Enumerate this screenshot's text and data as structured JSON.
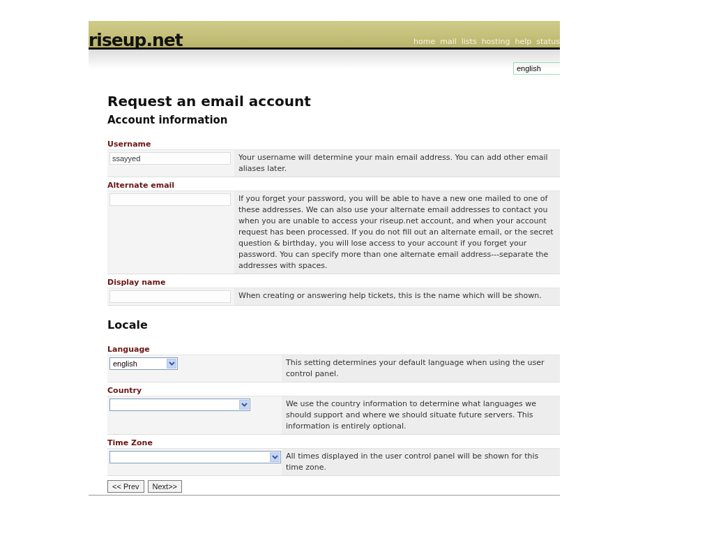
{
  "header": {
    "logo": "riseup.net",
    "nav": [
      "home",
      "mail",
      "lists",
      "hosting",
      "help",
      "status"
    ],
    "language_select": {
      "value": "english"
    }
  },
  "title": "Request an email account",
  "sections": [
    {
      "heading": "Account information",
      "fields": [
        {
          "label": "Username",
          "kind": "text",
          "value": "ssayyed",
          "help": "Your username will determine your main email address. You can add other email aliases later."
        },
        {
          "label": "Alternate email",
          "kind": "text",
          "help": "If you forget your password, you will be able to have a new one mailed to one of these addresses. We can also use your alternate email addresses to contact you when you are unable to access your riseup.net account, and when your account request has been processed. If you do not fill out an alternate email, or the secret question & birthday, you will lose access to your account if you forget your password. You can specify more than one alternate email address---separate the addresses with spaces."
        },
        {
          "label": "Display name",
          "kind": "text",
          "help": "When creating or answering help tickets, this is the name which will be shown."
        }
      ]
    },
    {
      "heading": "Locale",
      "fields": [
        {
          "label": "Language",
          "kind": "select",
          "value": "english",
          "help": "This setting determines your default language when using the user control panel."
        },
        {
          "label": "Country",
          "kind": "select",
          "help": "We use the country information to determine what languages we should support and where we should situate future servers. This information is entirely optional."
        },
        {
          "label": "Time Zone",
          "kind": "select",
          "help": "All times displayed in the user control panel will be shown for this time zone."
        }
      ]
    }
  ],
  "buttons": [
    "<< Prev",
    "Next>>"
  ]
}
